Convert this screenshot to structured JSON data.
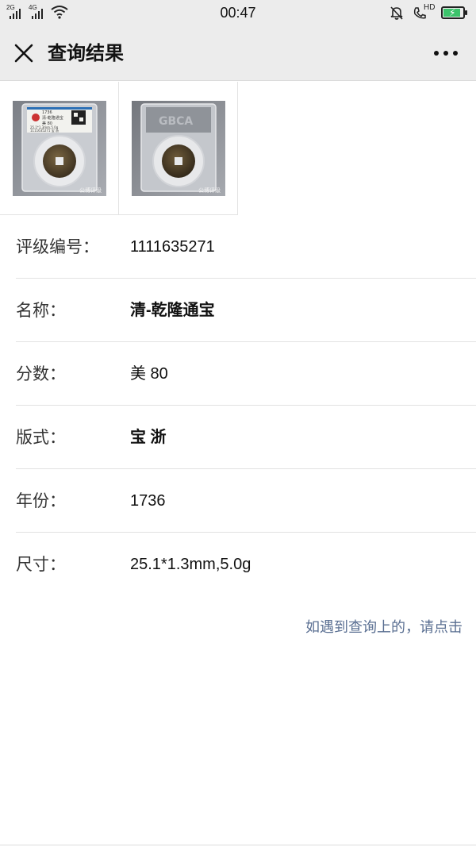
{
  "status_bar": {
    "time": "00:47",
    "network_left": "2G",
    "network_right": "4G",
    "volte_label": "HD",
    "battery_level": 0.8,
    "battery_color": "#3cc36b",
    "icons": [
      "signal-icon",
      "signal-icon",
      "wifi-icon",
      "mute-bell-icon",
      "volte-call-icon",
      "battery-charging-icon"
    ]
  },
  "nav": {
    "title": "查询结果",
    "close_icon": "close-icon",
    "more_icon": "more-icon"
  },
  "images": {
    "watermark": "公博评级",
    "slab_label_lines": [
      "1736",
      "清-乾隆通宝",
      "美 80",
      "25.1*1.3mm,5.0g",
      "1111635271 宝 浙"
    ],
    "back_logo": "GBCA"
  },
  "details": [
    {
      "key": "评级编号：",
      "value": "1111635271"
    },
    {
      "key": "名称：",
      "value": "清-乾隆通宝"
    },
    {
      "key": "分数：",
      "value": "美 80"
    },
    {
      "key": "版式：",
      "value": "宝 浙"
    },
    {
      "key": "年份：",
      "value": "1736"
    },
    {
      "key": "尺寸：",
      "value": "25.1*1.3mm,5.0g"
    }
  ],
  "help_link": "如遇到查询上的，请点击",
  "colors": {
    "header_bg": "#ececec",
    "link": "#5a6f92"
  }
}
